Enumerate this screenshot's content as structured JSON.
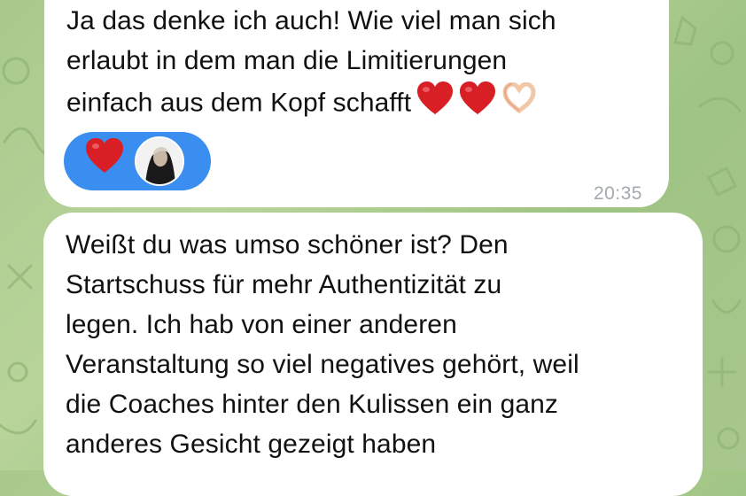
{
  "chat": {
    "messages": [
      {
        "text": "Ja das denke ich auch! Wie viel man sich\nerlaubt in dem man die Limitierungen\neinfach aus dem Kopf schafft",
        "inline_emojis": [
          "red-heart-icon",
          "red-heart-icon",
          "heart-hands-icon"
        ],
        "reaction": {
          "emoji": "red-heart-icon",
          "reactor": "avatar"
        },
        "time": "20:35"
      },
      {
        "text": "Weißt du was umso schöner ist? Den\nStartschuss für mehr Authentizität zu\nlegen. Ich hab von einer anderen\nVeranstaltung so viel negatives gehört, weil\ndie Coaches hinter den Kulissen ein ganz\nanderes Gesicht gezeigt haben"
      }
    ]
  },
  "colors": {
    "background": "#a9c98c",
    "bubble": "#ffffff",
    "reaction_pill": "#3a8ef0",
    "heart": "#d81f26",
    "timestamp": "#a4a9ad"
  }
}
